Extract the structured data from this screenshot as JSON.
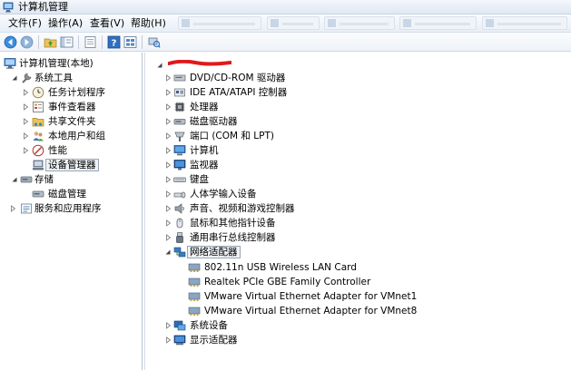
{
  "window": {
    "title": "计算机管理"
  },
  "menubar": {
    "items": [
      {
        "label": "文件(F)"
      },
      {
        "label": "操作(A)"
      },
      {
        "label": "查看(V)"
      },
      {
        "label": "帮助(H)"
      }
    ]
  },
  "left_tree": {
    "root": "计算机管理(本地)",
    "system_tools": {
      "label": "系统工具",
      "children": [
        {
          "label": "任务计划程序",
          "icon": "clock-icon"
        },
        {
          "label": "事件查看器",
          "icon": "event-viewer-icon"
        },
        {
          "label": "共享文件夹",
          "icon": "shared-folder-icon"
        },
        {
          "label": "本地用户和组",
          "icon": "users-icon"
        },
        {
          "label": "性能",
          "icon": "performance-icon"
        },
        {
          "label": "设备管理器",
          "icon": "device-manager-icon",
          "selected": true
        }
      ]
    },
    "storage": {
      "label": "存储",
      "children": [
        {
          "label": "磁盘管理",
          "icon": "disk-management-icon"
        }
      ]
    },
    "services": {
      "label": "服务和应用程序"
    }
  },
  "device_tree": {
    "categories_top": [
      {
        "label": "DVD/CD-ROM 驱动器",
        "icon": "dvd-icon"
      },
      {
        "label": "IDE ATA/ATAPI 控制器",
        "icon": "ide-controller-icon"
      },
      {
        "label": "处理器",
        "icon": "processor-icon"
      },
      {
        "label": "磁盘驱动器",
        "icon": "disk-drive-icon"
      },
      {
        "label": "端口 (COM 和 LPT)",
        "icon": "port-icon"
      },
      {
        "label": "计算机",
        "icon": "computer-icon"
      },
      {
        "label": "监视器",
        "icon": "monitor-icon"
      },
      {
        "label": "键盘",
        "icon": "keyboard-icon"
      },
      {
        "label": "人体学输入设备",
        "icon": "hid-icon"
      },
      {
        "label": "声音、视频和游戏控制器",
        "icon": "sound-icon"
      },
      {
        "label": "鼠标和其他指针设备",
        "icon": "mouse-icon"
      },
      {
        "label": "通用串行总线控制器",
        "icon": "usb-icon"
      }
    ],
    "network": {
      "label": "网络适配器",
      "children": [
        "802.11n USB Wireless LAN Card",
        "Realtek PCIe GBE Family Controller",
        "VMware Virtual Ethernet Adapter for VMnet1",
        "VMware Virtual Ethernet Adapter for VMnet8"
      ]
    },
    "categories_bottom": [
      {
        "label": "系统设备",
        "icon": "system-devices-icon"
      },
      {
        "label": "显示适配器",
        "icon": "display-adapter-icon"
      }
    ]
  },
  "colors": {
    "selection_border": "#9aa6b5",
    "redaction": "#e0191b",
    "accent": "#2f6fc0"
  }
}
